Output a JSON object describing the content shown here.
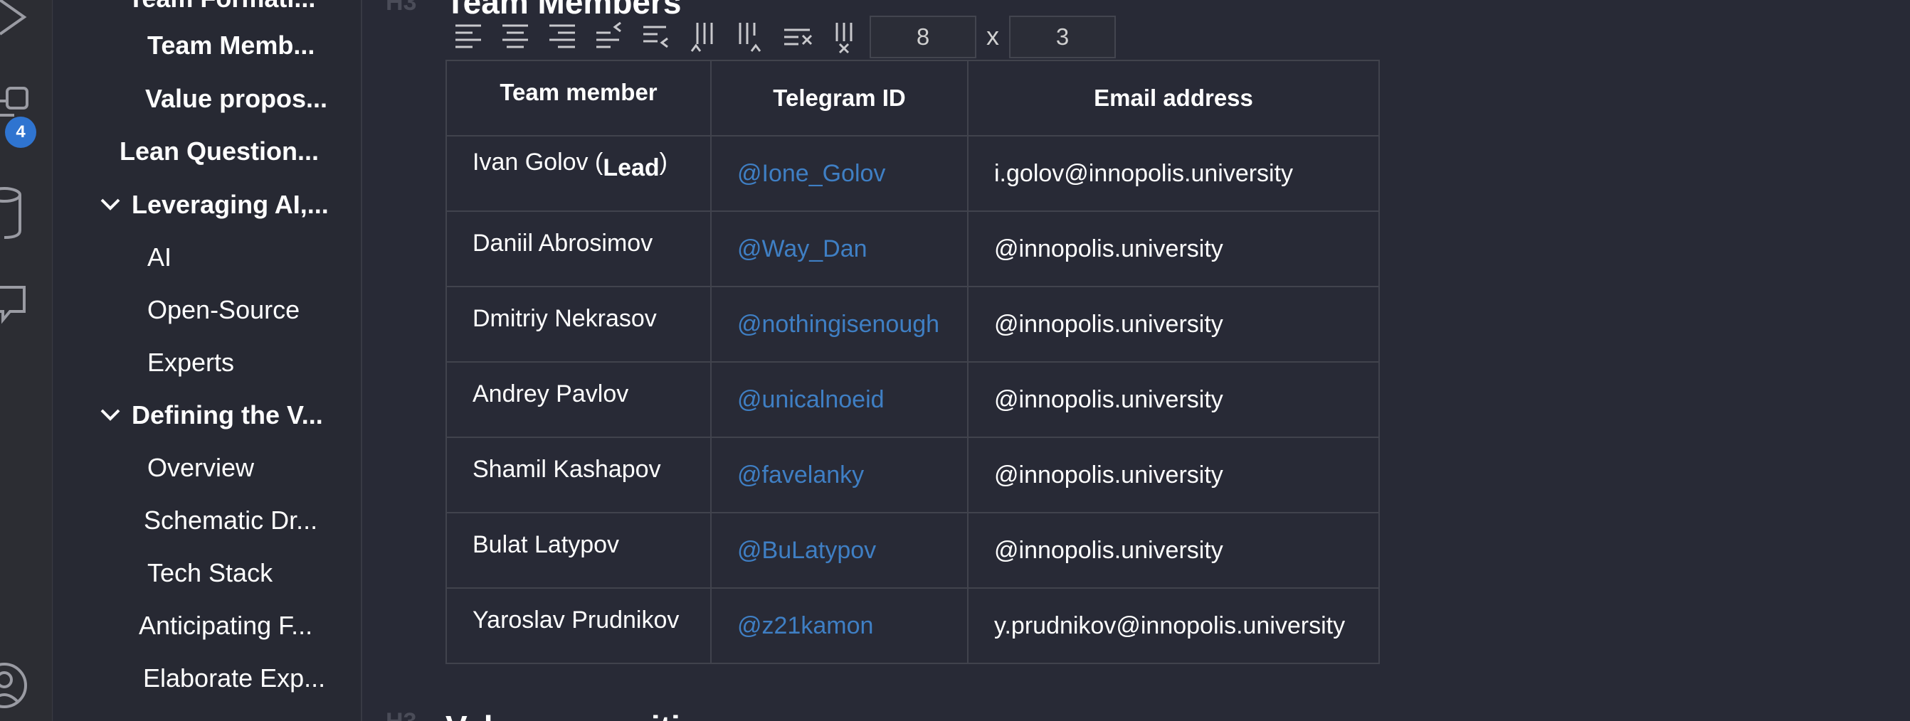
{
  "activity_bar": {
    "badge_count": "4",
    "icons": [
      "run-debug-icon",
      "extensions-icon",
      "database-icon",
      "comments-icon",
      "account-icon"
    ]
  },
  "outline": {
    "items": [
      {
        "label": "Team Formati...",
        "bold": true
      },
      {
        "label": "Team Memb...",
        "bold": true
      },
      {
        "label": "Value propos...",
        "bold": true
      },
      {
        "label": "Lean Question...",
        "bold": true
      },
      {
        "label": "Leveraging AI,...",
        "bold": true,
        "expanded": true
      },
      {
        "label": "AI",
        "bold": false
      },
      {
        "label": "Open-Source",
        "bold": false
      },
      {
        "label": "Experts",
        "bold": false
      },
      {
        "label": "Defining the V...",
        "bold": true,
        "expanded": true
      },
      {
        "label": "Overview",
        "bold": false
      },
      {
        "label": "Schematic Dr...",
        "bold": false
      },
      {
        "label": "Tech Stack",
        "bold": false
      },
      {
        "label": "Anticipating F...",
        "bold": false
      },
      {
        "label": "Elaborate Exp...",
        "bold": false
      }
    ]
  },
  "editor": {
    "heading_marker": "H3",
    "heading": "Team Members",
    "next_heading_marker": "H3",
    "next_heading": "Value proposition",
    "table_toolbar": {
      "icons": [
        "align-left-icon",
        "align-center-icon",
        "align-right-icon",
        "insert-row-above-icon",
        "insert-row-below-icon",
        "insert-column-left-icon",
        "insert-column-right-icon",
        "delete-row-icon",
        "delete-column-icon"
      ],
      "rows": "8",
      "x_label": "x",
      "cols": "3"
    },
    "table": {
      "headers": [
        "Team member",
        "Telegram ID",
        "Email address"
      ],
      "rows": [
        {
          "name": "Ivan Golov (",
          "name_bold": "Lead",
          "name_tail": ")",
          "telegram": "@Ione_Golov",
          "email": "i.golov@innopolis.university"
        },
        {
          "name": "Daniil Abrosimov",
          "telegram": "@Way_Dan",
          "email": "@innopolis.university"
        },
        {
          "name": "Dmitriy Nekrasov",
          "telegram": "@nothingisenough",
          "email": "@innopolis.university"
        },
        {
          "name": "Andrey Pavlov",
          "telegram": "@unicalnoeid",
          "email": "@innopolis.university"
        },
        {
          "name": "Shamil Kashapov",
          "telegram": "@favelanky",
          "email": "@innopolis.university"
        },
        {
          "name": "Bulat Latypov",
          "telegram": "@BuLatypov",
          "email": "@innopolis.university"
        },
        {
          "name": "Yaroslav Prudnikov",
          "telegram": "@z21kamon",
          "email": "y.prudnikov@innopolis.university"
        }
      ]
    }
  },
  "colors": {
    "background": "#282a36",
    "link": "#3f7fc4",
    "badge": "#2f74d0",
    "border": "#41434d"
  }
}
